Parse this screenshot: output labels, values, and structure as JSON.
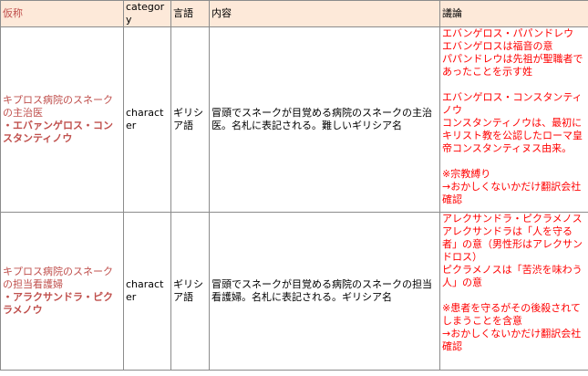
{
  "headers": {
    "name": "仮称",
    "category": "category",
    "language": "言語",
    "content": "内容",
    "discussion": "議論"
  },
  "rows": [
    {
      "name_desc": "キプロス病院のスネークの主治医",
      "name_strong": "・エバァンゲロス・コンスタンティノウ",
      "category": "character",
      "language": "ギリシア語",
      "content": "冒頭でスネークが目覚める病院のスネークの主治医。名札に表記される。難しいギリシア名",
      "discussion": {
        "block1": "エバンゲロス・パパンドレウ\nエバンゲロスは福音の意\nパパンドレウは先祖が聖職者であったことを示す姓",
        "block2": "エバンゲロス・コンスタンティノウ\nコンスタンティノウは、最初にキリスト教を公認したローマ皇帝コンスタンティヌス由来。",
        "block3": "※宗教縛り\n→おかしくないかだけ翻訳会社確認"
      }
    },
    {
      "name_desc": "キプロス病院のスネークの担当看護婦",
      "name_strong": "・アラクサンドラ・ピクラメノウ",
      "category": "character",
      "language": "ギリシア語",
      "content": "冒頭でスネークが目覚める病院のスネークの担当看護婦。名札に表記される。ギリシア名",
      "discussion": {
        "block1": "アレクサンドラ・ピクラメノス\nアレクサンドラは「人を守る者」の意（男性形はアレクサンドロス）\nピクラメノスは「苦渋を味わう人」の意",
        "block2": "※患者を守るがその後殺されてしまうことを含意\n→おかしくないかだけ翻訳会社確認"
      }
    }
  ]
}
